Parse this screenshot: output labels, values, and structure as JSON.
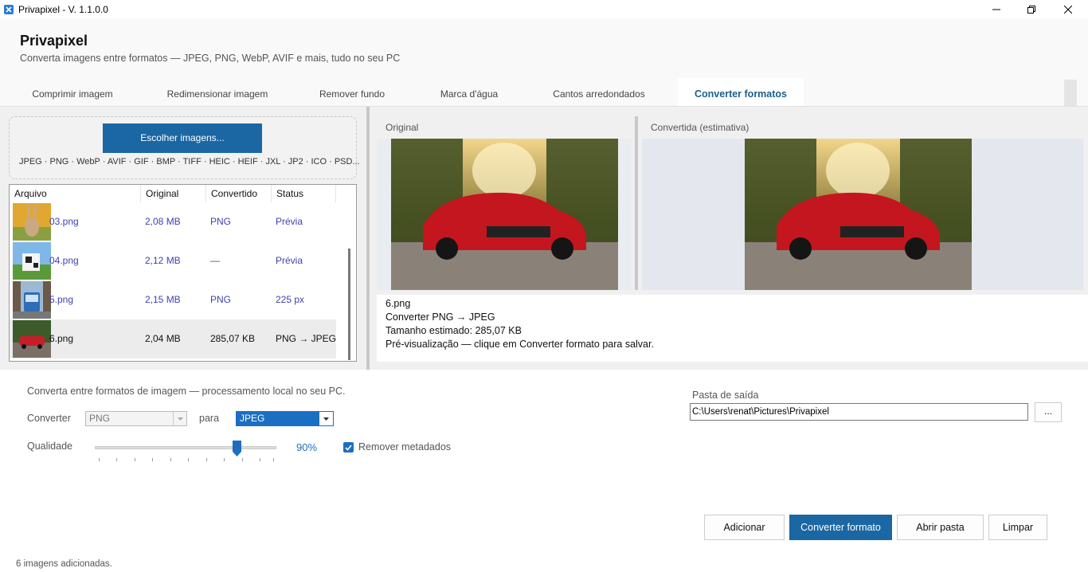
{
  "window": {
    "title": "Privapixel - V. 1.1.0.0"
  },
  "header": {
    "app_name": "Privapixel",
    "subtitle": "Converta imagens entre formatos — JPEG, PNG, WebP, AVIF e mais, tudo no seu PC"
  },
  "tabs": [
    {
      "label": "Comprimir imagem"
    },
    {
      "label": "Redimensionar imagem"
    },
    {
      "label": "Remover fundo"
    },
    {
      "label": "Marca d'água"
    },
    {
      "label": "Cantos arredondados"
    },
    {
      "label": "Converter formatos",
      "active": true
    }
  ],
  "left": {
    "choose_button": "Escolher imagens...",
    "formats_text": "JPEG · PNG · WebP · AVIF · GIF · BMP · TIFF · HEIC · HEIF · JXL · JP2 · ICO · PSD...",
    "table": {
      "headers": [
        "Arquivo",
        "Original",
        "Convertido",
        "Status"
      ],
      "rows": [
        {
          "file": "03.png",
          "original": "2,08 MB",
          "converted": "PNG",
          "status": "Prévia",
          "thumb": "rabbit"
        },
        {
          "file": "04.png",
          "original": "2,12 MB",
          "converted": "—",
          "status": "Prévia",
          "thumb": "cow"
        },
        {
          "file": "5.png",
          "original": "2,15 MB",
          "converted": "PNG",
          "status": "225 px",
          "thumb": "bus"
        },
        {
          "file": "6.png",
          "original": "2,04 MB",
          "converted": "285,07 KB",
          "status": "PNG → JPEG",
          "thumb": "car",
          "selected": true
        }
      ]
    }
  },
  "preview": {
    "original_label": "Original",
    "converted_label": "Convertida (estimativa)",
    "info": [
      "6.png",
      "Converter PNG → JPEG",
      "Tamanho estimado: 285,07 KB",
      "Pré-visualização — clique em Converter formato para salvar."
    ]
  },
  "settings": {
    "description": "Converta entre formatos de imagem — processamento local no seu PC.",
    "convert_label": "Converter",
    "from_format": "PNG",
    "to_label": "para",
    "to_format": "JPEG",
    "quality_label": "Qualidade",
    "quality_value": "90%",
    "quality_fraction": 0.9,
    "remove_metadata_label": "Remover metadados",
    "remove_metadata_checked": true,
    "output_folder_label": "Pasta de saída",
    "output_folder_value": "C:\\Users\\renat\\Pictures\\Privapixel",
    "browse_label": "..."
  },
  "actions": {
    "add": "Adicionar",
    "convert": "Converter formato",
    "open_folder": "Abrir pasta",
    "clear": "Limpar"
  },
  "status_bar": {
    "text": "6 imagens adicionadas."
  },
  "colors": {
    "accent": "#1b67a3",
    "link_text": "#4040b0",
    "checkbox": "#1b6fc2"
  }
}
